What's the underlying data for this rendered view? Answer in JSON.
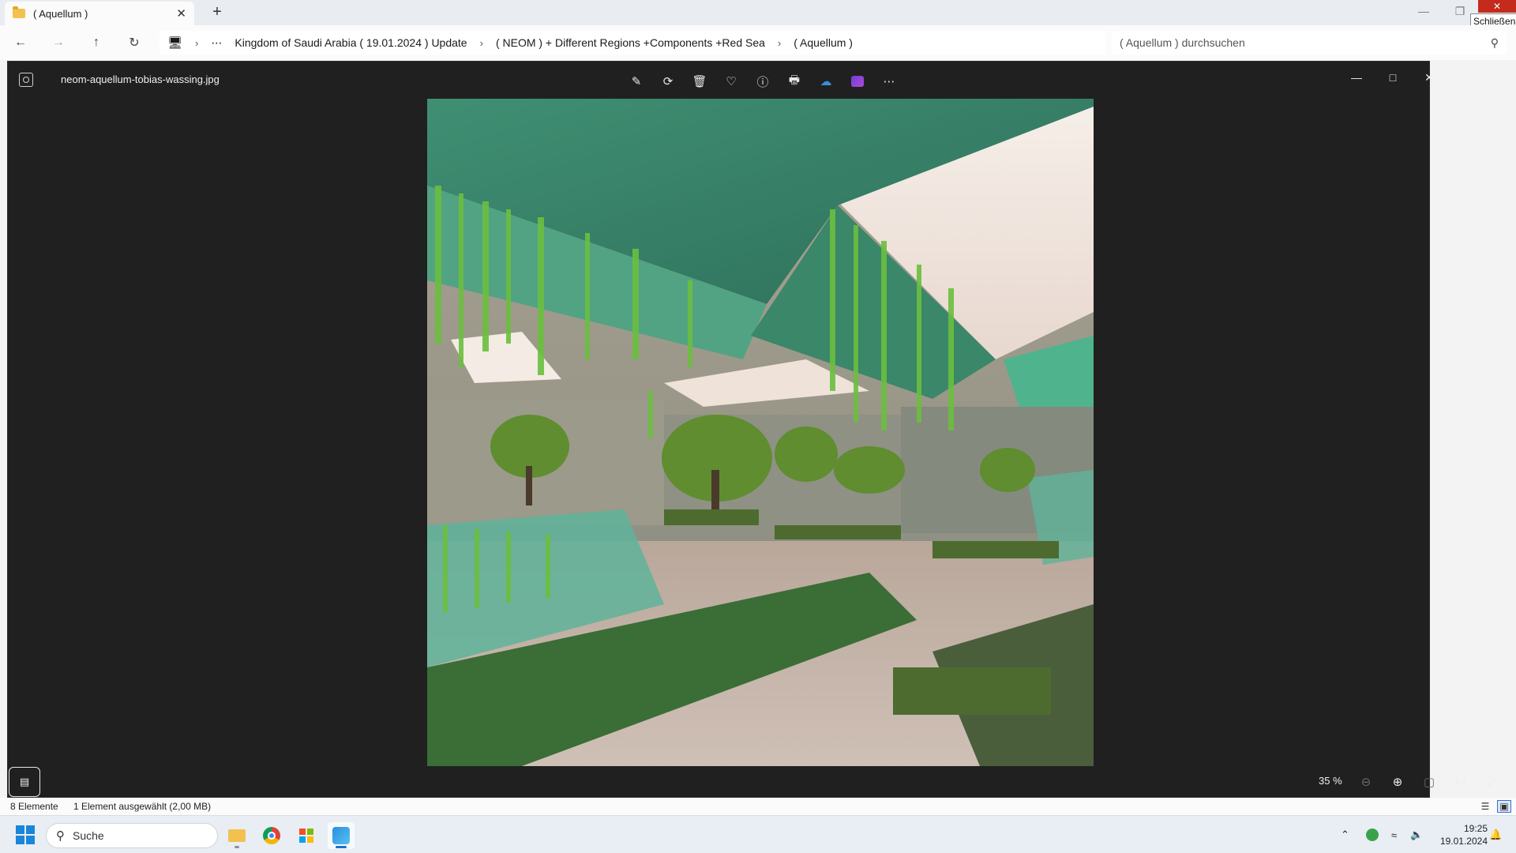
{
  "explorer": {
    "tab_title": "( Aquellum )",
    "tab_close": "✕",
    "new_tab": "+",
    "tooltip": "Schließen",
    "breadcrumb": [
      "Kingdom of Saudi Arabia ( 19.01.2024 ) Update",
      "( NEOM ) + Different Regions +Components +Red Sea",
      "( Aquellum )"
    ],
    "search_placeholder": "( Aquellum ) durchsuchen",
    "status_items": "8 Elemente",
    "status_selected": "1 Element ausgewählt (2,00 MB)"
  },
  "viewer": {
    "filename": "neom-aquellum-tobias-wassing.jpg",
    "zoom": "35 %",
    "toolbar": [
      "edit-image-icon",
      "rotate-icon",
      "delete-icon",
      "favorite-heart-icon",
      "info-icon",
      "print-icon",
      "onedrive-icon",
      "clipchamp-icon",
      "more-icon"
    ]
  },
  "taskbar": {
    "search_label": "Suche",
    "time": "19:25",
    "date": "19.01.2024"
  },
  "colors": {
    "viewer_bg": "#202020",
    "accent": "#1a6fd0",
    "close_red": "#c42b1c"
  }
}
